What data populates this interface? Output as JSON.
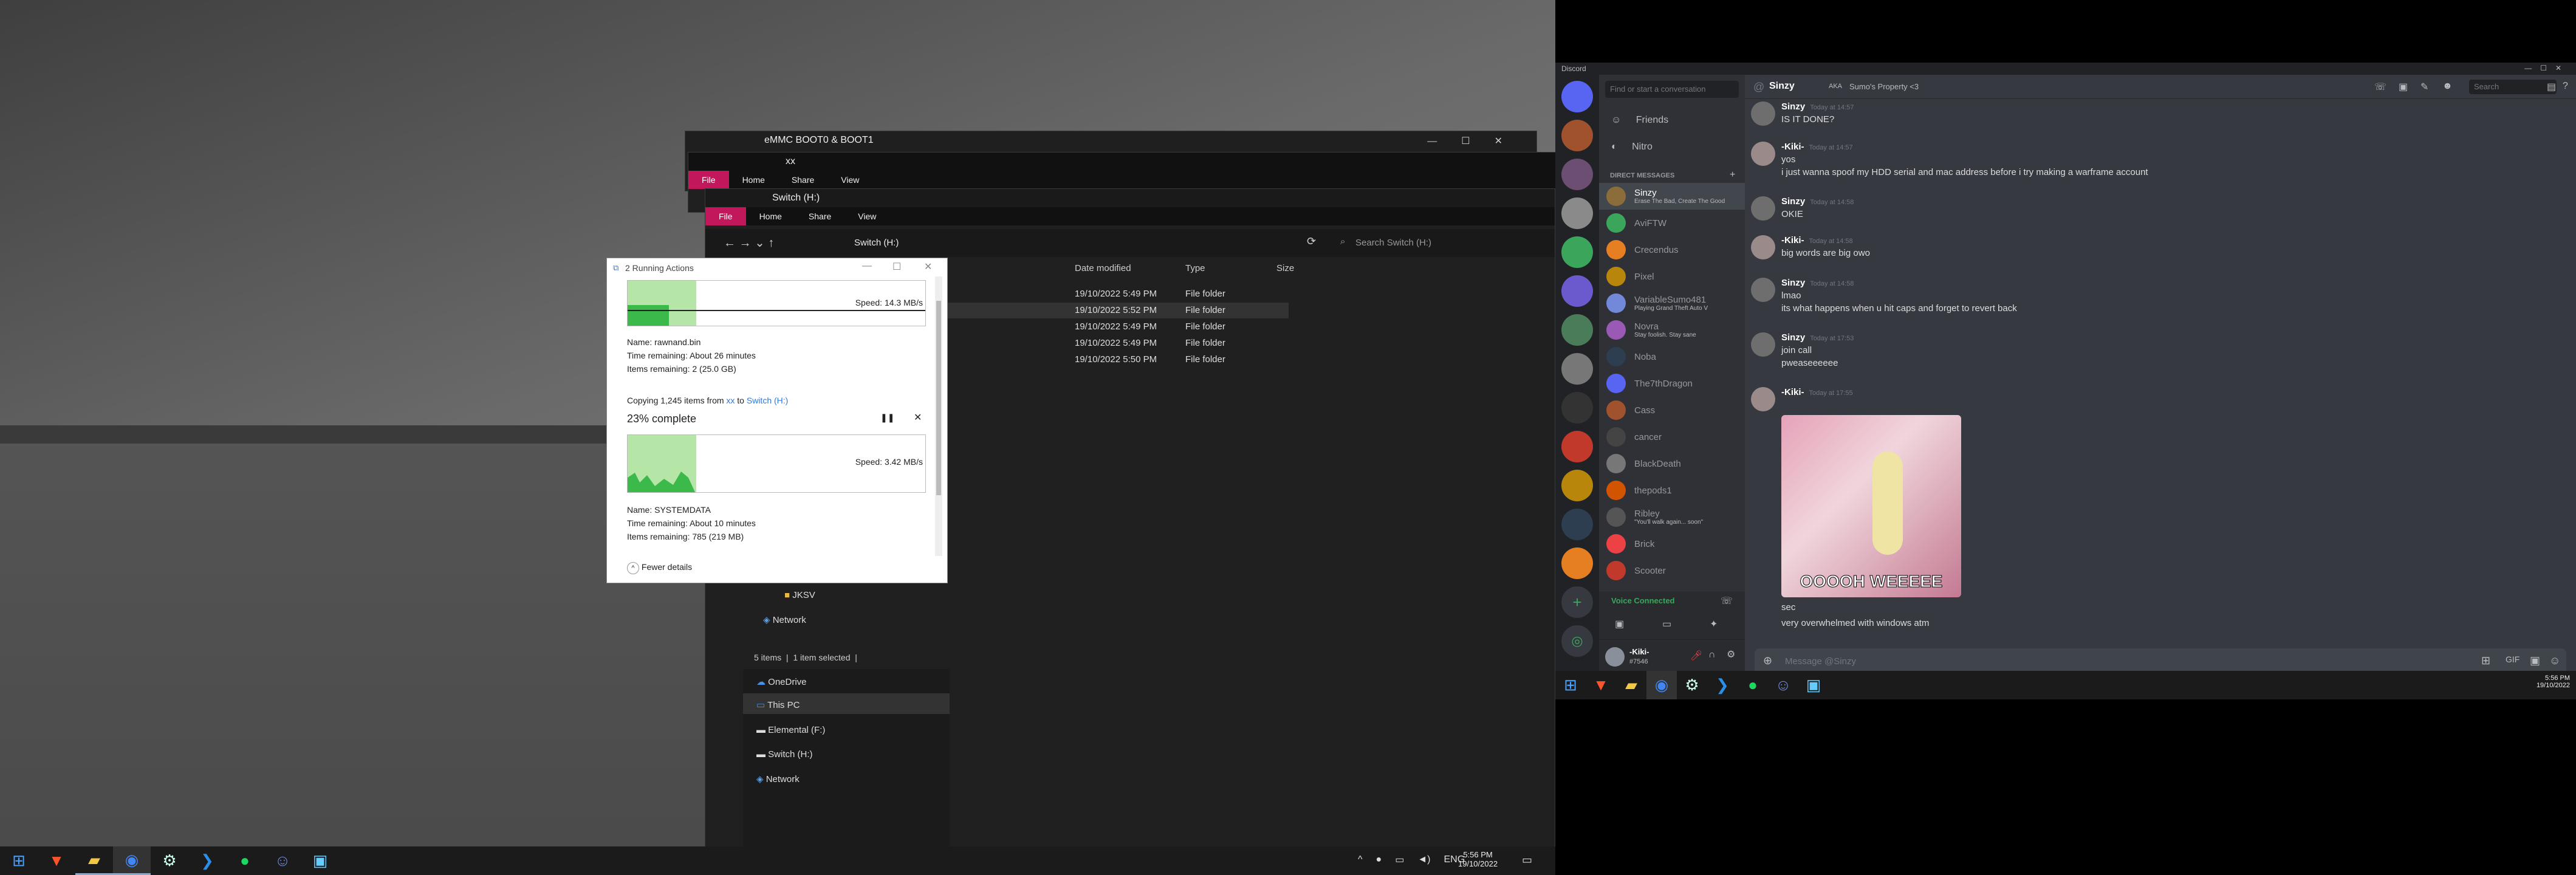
{
  "explorer_back": {
    "title": "eMMC BOOT0 & BOOT1"
  },
  "explorer_mid": {
    "path": "xx"
  },
  "explorer_front": {
    "title": "Switch (H:)",
    "tabs": [
      "File",
      "Home",
      "Share",
      "View"
    ],
    "breadcrumb": "Switch (H:)",
    "search_placeholder": "Search Switch (H:)",
    "columns": [
      "Date modified",
      "Type",
      "Size"
    ],
    "rows": [
      {
        "date": "19/10/2022 5:49 PM",
        "type": "File folder"
      },
      {
        "date": "19/10/2022 5:52 PM",
        "type": "File folder"
      },
      {
        "date": "19/10/2022 5:49 PM",
        "type": "File folder"
      },
      {
        "date": "19/10/2022 5:49 PM",
        "type": "File folder"
      },
      {
        "date": "19/10/2022 5:50 PM",
        "type": "File folder"
      }
    ],
    "nav_items": [
      "JKSV",
      "Network"
    ],
    "status": "5 items  |  1 item selected  |"
  },
  "explorer_bottom_nav": [
    "OneDrive",
    "This PC",
    "Elemental (F:)",
    "Switch (H:)",
    "Network"
  ],
  "dialog": {
    "title": "2 Running Actions",
    "op1": {
      "speed": "Speed: 14.3 MB/s",
      "name": "Name: rawnand.bin",
      "time": "Time remaining: About 26 minutes",
      "items": "Items remaining: 2 (25.0 GB)",
      "progress": 0.23
    },
    "op2": {
      "copy_prefix": "Copying 1,245 items from ",
      "from": "xx",
      "to_word": " to ",
      "to": "Switch (H:)",
      "complete": "23% complete",
      "speed": "Speed: 3.42 MB/s",
      "name": "Name: SYSTEMDATA",
      "time": "Time remaining: About 10 minutes",
      "items": "Items remaining: 785 (219 MB)",
      "progress": 0.23
    },
    "fewer": "Fewer details"
  },
  "taskbar_left": {
    "time": "5:56 PM",
    "date": "19/10/2022",
    "lang": "ENG"
  },
  "discord": {
    "app": "Discord",
    "search_placeholder": "Find or start a conversation",
    "nav": [
      "Friends",
      "Nitro"
    ],
    "dm_header": "DIRECT MESSAGES",
    "dms": [
      {
        "name": "Sinzy",
        "sub": "Erase The Bad, Create The Good"
      },
      {
        "name": "AviFTW",
        "sub": ""
      },
      {
        "name": "Crecendus",
        "sub": ""
      },
      {
        "name": "Pixel",
        "sub": ""
      },
      {
        "name": "VariableSumo481",
        "sub": "Playing Grand Theft Auto V"
      },
      {
        "name": "Novra",
        "sub": "Stay foolish. Stay sane"
      },
      {
        "name": "Noba",
        "sub": ""
      },
      {
        "name": "The7thDragon",
        "sub": ""
      },
      {
        "name": "Cass",
        "sub": ""
      },
      {
        "name": "cancer",
        "sub": ""
      },
      {
        "name": "BlackDeath",
        "sub": ""
      },
      {
        "name": "thepods1",
        "sub": ""
      },
      {
        "name": "Ribley",
        "sub": "\"You'll walk again... soon\""
      },
      {
        "name": "Brick",
        "sub": ""
      },
      {
        "name": "Scooter",
        "sub": ""
      }
    ],
    "voice": "Voice Connected",
    "user": {
      "name": "-Kiki-",
      "tag": "#7546"
    },
    "channel": {
      "name": "Sinzy",
      "aka": "AKA",
      "aka_value": "Sumo's Property <3"
    },
    "header_search": "Search",
    "messages": [
      {
        "author": "Sinzy",
        "time": "Today at 14:57",
        "lines": [
          "IS IT DONE?"
        ]
      },
      {
        "author": "-Kiki-",
        "time": "Today at 14:57",
        "lines": [
          "yos",
          "i just wanna spoof my HDD serial and mac address before i try making a warframe account"
        ]
      },
      {
        "author": "Sinzy",
        "time": "Today at 14:58",
        "lines": [
          "OKIE"
        ]
      },
      {
        "author": "-Kiki-",
        "time": "Today at 14:58",
        "lines": [
          "big words are big owo"
        ]
      },
      {
        "author": "Sinzy",
        "time": "Today at 14:58",
        "lines": [
          "lmao",
          "its what happens when u hit caps and forget to revert back"
        ]
      },
      {
        "author": "Sinzy",
        "time": "Today at 17:53",
        "lines": [
          "join call",
          "pweaseeeeee"
        ]
      },
      {
        "author": "-Kiki-",
        "time": "Today at 17:55",
        "lines": []
      }
    ],
    "gif_caption": "OOOOH WEEEEE",
    "after_gif": [
      "sec",
      "very overwhelmed with windows atm"
    ],
    "input_placeholder": "Message @Sinzy"
  },
  "taskbar_right": {
    "time": "5:56 PM",
    "date": "19/10/2022"
  }
}
